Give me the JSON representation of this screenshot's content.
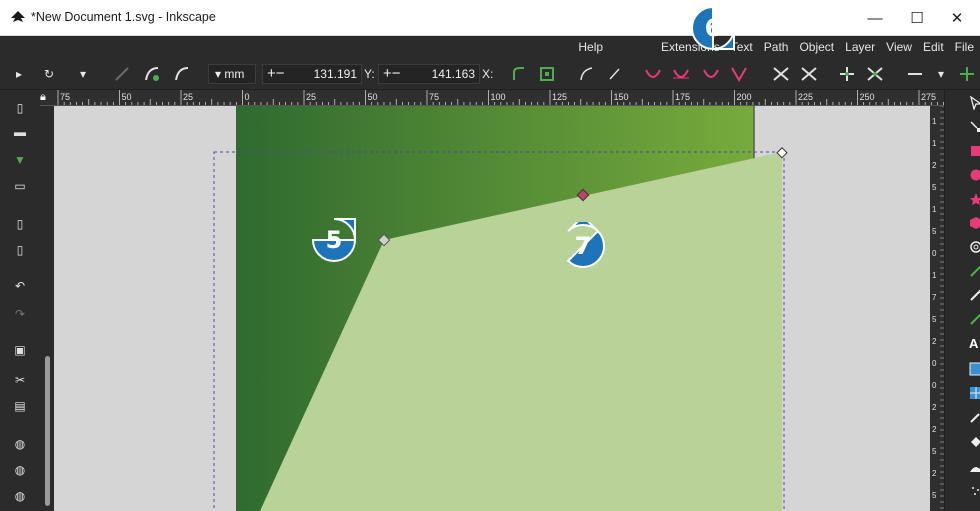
{
  "window": {
    "title": "*New Document 1.svg - Inkscape",
    "minimize_glyph": "—",
    "maximize_glyph": "☐",
    "close_glyph": "✕"
  },
  "menu": [
    "File",
    "Edit",
    "View",
    "Layer",
    "Object",
    "Path",
    "Text",
    "Extensions",
    "Help"
  ],
  "toolbar": {
    "unit": "mm",
    "x_label": "X:",
    "x_value": "141.163",
    "y_label": "Y:",
    "y_value": "131.191",
    "plus_minus": "+−"
  },
  "ruler": {
    "labels": [
      "75",
      "50",
      "25",
      "0",
      "25",
      "50",
      "75",
      "100",
      "125",
      "150",
      "175",
      "200",
      "225",
      "250",
      "275"
    ],
    "left_labels": [
      "1",
      "1",
      "2",
      "5",
      "1",
      "5",
      "0",
      "1",
      "7",
      "5",
      "2",
      "0",
      "0",
      "2",
      "2",
      "5",
      "2",
      "5"
    ]
  },
  "callouts": [
    "5",
    "6",
    "7"
  ],
  "colors": {
    "page_dark": "#2f6a2f",
    "page_light_green": "#78ab3c",
    "shape_fill": "#b8d298",
    "callout_blue": "#1e74b8"
  },
  "icons": {
    "left": [
      "new-document-icon",
      "open-icon",
      "save-icon",
      "print-icon",
      "import-icon",
      "export-icon",
      "undo-icon",
      "redo-icon",
      "copy-icon",
      "cut-icon",
      "paste-icon",
      "zoom-selection-icon",
      "zoom-drawing-icon",
      "zoom-page-icon"
    ],
    "right": [
      "selector-icon",
      "node-icon",
      "rectangle-icon",
      "circle-icon",
      "star-icon",
      "box3d-icon",
      "spiral-icon",
      "pencil-icon",
      "pen-icon",
      "calligraphy-icon",
      "text-icon",
      "gradient-icon",
      "mesh-icon",
      "dropper-icon",
      "paint-bucket-icon",
      "tweak-icon",
      "spray-icon"
    ]
  }
}
